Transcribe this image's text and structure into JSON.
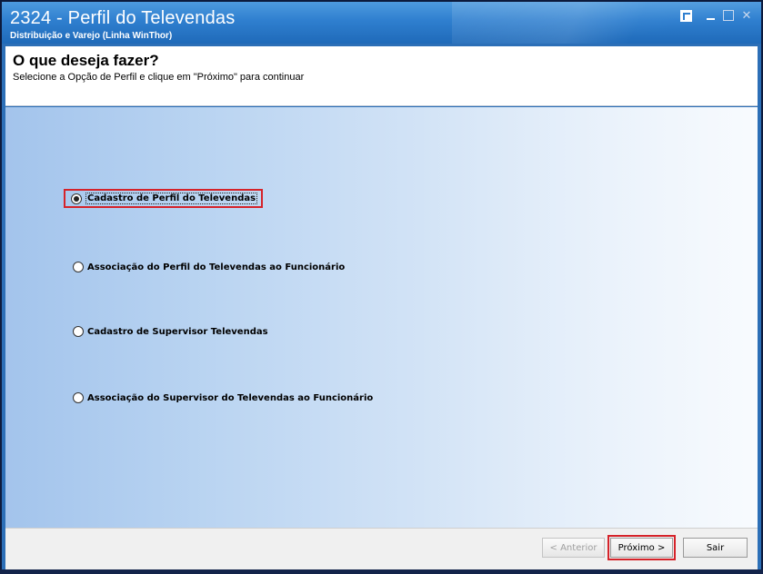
{
  "window": {
    "title": "2324 - Perfil do Televendas",
    "subtitle": "Distribuição e Varejo (Linha WinThor)"
  },
  "header": {
    "heading": "O que deseja fazer?",
    "instruction": "Selecione a Opção de Perfil e clique em \"Próximo\" para continuar"
  },
  "options": [
    {
      "label": "Cadastro de Perfil do Televendas",
      "checked": true
    },
    {
      "label": "Associação do Perfil do Televendas ao Funcionário",
      "checked": false
    },
    {
      "label": "Cadastro de Supervisor Televendas",
      "checked": false
    },
    {
      "label": "Associação do Supervisor do Televendas ao Funcionário",
      "checked": false
    }
  ],
  "footer": {
    "back_label": "< Anterior",
    "next_label": "Próximo >",
    "exit_label": "Sair"
  },
  "colors": {
    "titlebar": "#2f7fcf",
    "highlight": "#d5232a"
  }
}
